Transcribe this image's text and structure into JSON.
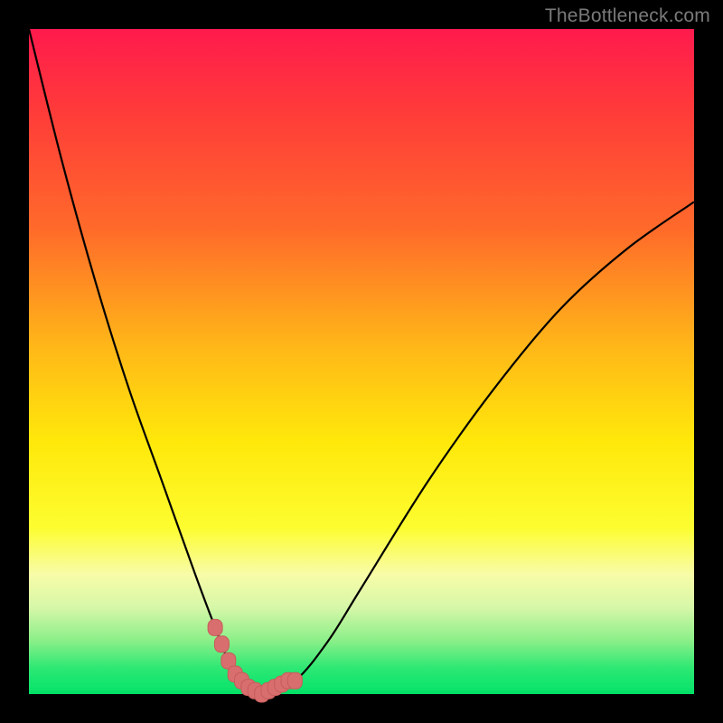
{
  "watermark": "TheBottleneck.com",
  "colors": {
    "bg": "#000000",
    "curve": "#000000",
    "marker": "#d86e6e",
    "marker_stroke": "#c85c5c"
  },
  "chart_data": {
    "type": "line",
    "title": "",
    "xlabel": "",
    "ylabel": "",
    "xlim": [
      0,
      100
    ],
    "ylim": [
      0,
      100
    ],
    "series": [
      {
        "name": "bottleneck-curve",
        "x": [
          0,
          5,
          10,
          15,
          20,
          25,
          28,
          30,
          32,
          35,
          40,
          45,
          50,
          60,
          70,
          80,
          90,
          100
        ],
        "values": [
          100,
          80,
          62,
          46,
          32,
          18,
          10,
          5,
          2,
          0,
          2,
          8,
          16,
          32,
          46,
          58,
          67,
          74
        ]
      }
    ],
    "markers": {
      "name": "highlight-segment",
      "x": [
        28,
        29,
        30,
        31,
        32,
        33,
        34,
        35,
        36,
        37,
        38,
        39,
        40
      ],
      "values": [
        10,
        7.5,
        5,
        3,
        2,
        1,
        0.5,
        0,
        0.5,
        1,
        1.5,
        2,
        2
      ]
    },
    "gradient_stops": [
      {
        "pos": 0,
        "color": "#ff1a4d"
      },
      {
        "pos": 12,
        "color": "#ff3a3a"
      },
      {
        "pos": 30,
        "color": "#ff6a2a"
      },
      {
        "pos": 48,
        "color": "#ffb818"
      },
      {
        "pos": 62,
        "color": "#ffe80a"
      },
      {
        "pos": 75,
        "color": "#fdfd30"
      },
      {
        "pos": 82,
        "color": "#f8fca8"
      },
      {
        "pos": 87,
        "color": "#d6f7a8"
      },
      {
        "pos": 92,
        "color": "#8aef88"
      },
      {
        "pos": 96,
        "color": "#2fe874"
      },
      {
        "pos": 100,
        "color": "#00e36a"
      }
    ]
  }
}
